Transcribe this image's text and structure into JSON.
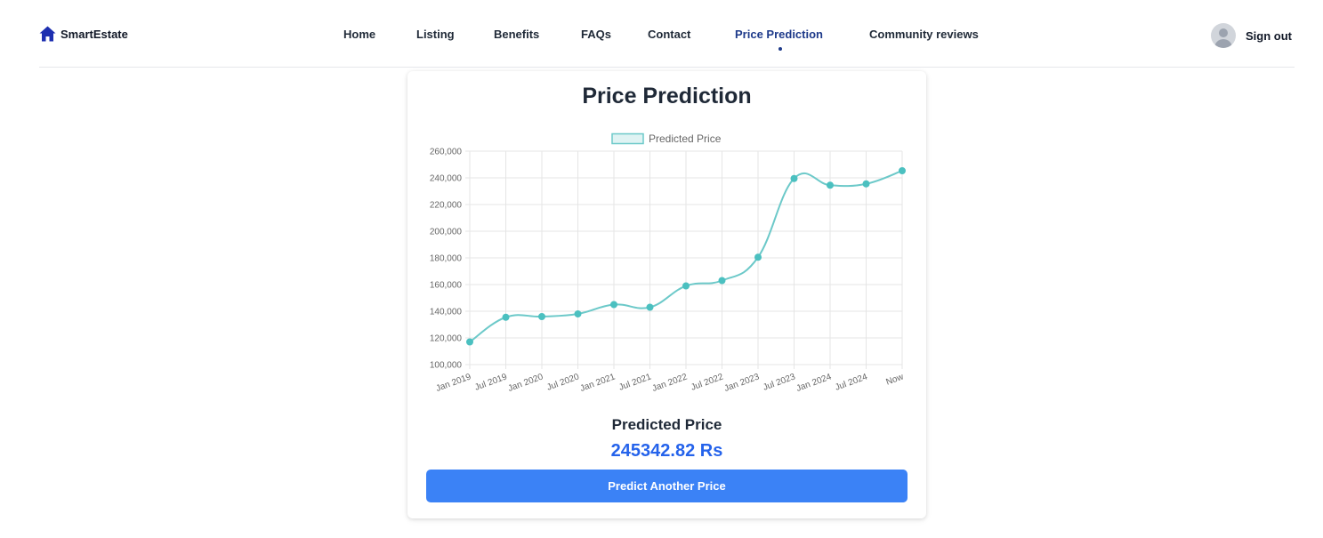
{
  "brand": {
    "name": "SmartEstate",
    "icon": "home-icon",
    "color": "#1d2fb0"
  },
  "nav": {
    "links": [
      {
        "label": "Home"
      },
      {
        "label": "Listing"
      },
      {
        "label": "Benefits"
      },
      {
        "label": "FAQs"
      },
      {
        "label": "Contact"
      },
      {
        "label": "Price Prediction",
        "active": true
      },
      {
        "label": "Community reviews"
      }
    ],
    "signout_label": "Sign out",
    "avatar_icon": "user-avatar-icon"
  },
  "card": {
    "title": "Price Prediction",
    "predicted_label": "Predicted Price",
    "predicted_value": "245342.82 Rs",
    "button_label": "Predict Another Price"
  },
  "colors": {
    "accent": "#3b82f6",
    "value": "#2563eb",
    "active_nav": "#1e3a8a",
    "series": "#6cc9c9"
  },
  "chart_data": {
    "type": "line",
    "title": "",
    "xlabel": "",
    "ylabel": "",
    "legend_position": "top",
    "grid": true,
    "ylim": [
      100000,
      260000
    ],
    "yticks": [
      "100,000",
      "120,000",
      "140,000",
      "160,000",
      "180,000",
      "200,000",
      "220,000",
      "240,000",
      "260,000"
    ],
    "categories": [
      "Jan 2019",
      "Jul 2019",
      "Jan 2020",
      "Jul 2020",
      "Jan 2021",
      "Jul 2021",
      "Jan 2022",
      "Jul 2022",
      "Jan 2023",
      "Jul 2023",
      "Jan 2024",
      "Jul 2024",
      "Now"
    ],
    "series": [
      {
        "name": "Predicted Price",
        "values": [
          117000,
          135500,
          136000,
          138000,
          145000,
          143000,
          159000,
          163000,
          180500,
          239500,
          234500,
          235500,
          245342.82
        ]
      }
    ]
  }
}
